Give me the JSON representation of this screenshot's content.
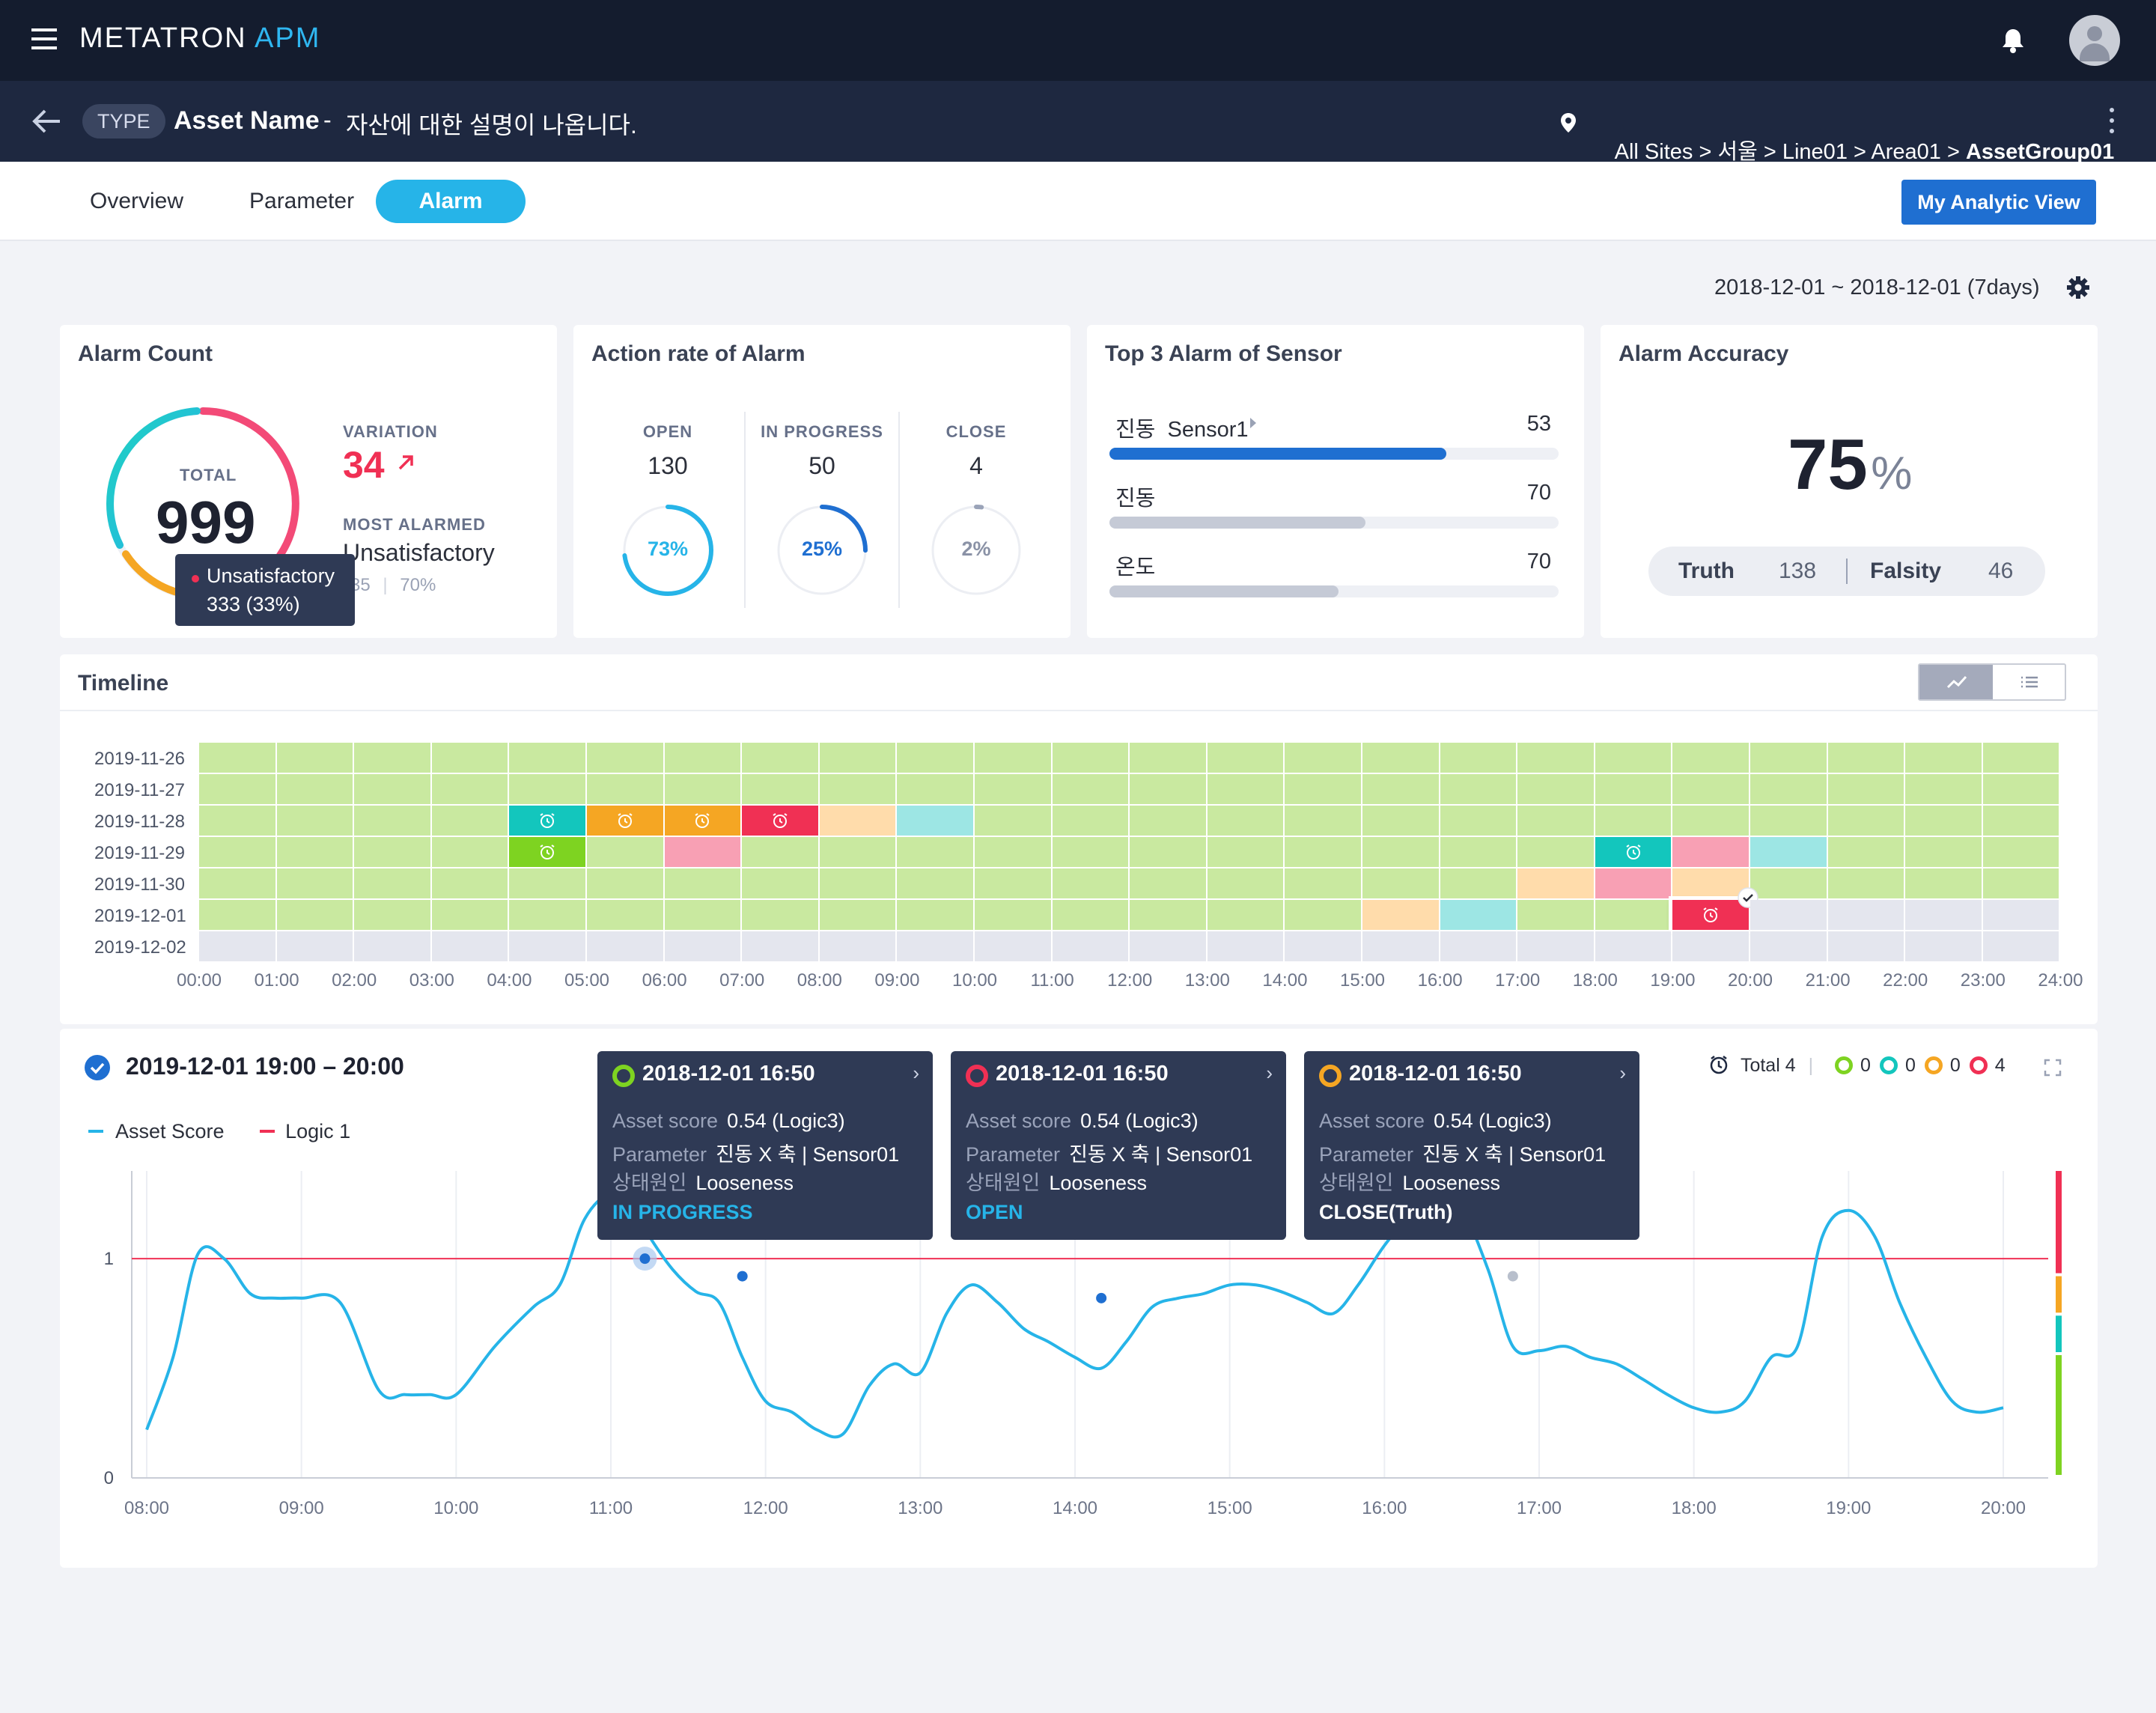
{
  "app": {
    "brand": "METATRON",
    "brand_accent": "APM"
  },
  "asset": {
    "type": "TYPE",
    "name": "Asset Name",
    "dash": "-",
    "description": "자산에 대한 설명이 나옵니다."
  },
  "breadcrumb": {
    "path": "All Sites > 서울 > Line01 > Area01 > ",
    "current": "AssetGroup01"
  },
  "tabs": [
    {
      "label": "Overview",
      "active": false
    },
    {
      "label": "Parameter",
      "active": false
    },
    {
      "label": "Alarm",
      "active": true
    }
  ],
  "my_view_button": "My Analytic View",
  "date_range": "2018-12-01 ~ 2018-12-01 (7days)",
  "alarm_count": {
    "title": "Alarm Count",
    "total_label": "TOTAL",
    "total": "999",
    "variation_label": "VARIATION",
    "variation": "34",
    "most_alarmed_label": "MOST ALARMED",
    "most_alarmed": "Unsatisfactory",
    "sub_count": "35",
    "sub_pct": "70%",
    "tooltip": {
      "label": "Unsatisfactory",
      "value": "333 (33%)"
    }
  },
  "action_rate": {
    "title": "Action rate of Alarm",
    "items": [
      {
        "label": "OPEN",
        "count": "130",
        "pct": "73%",
        "fraction": 0.73,
        "color": "#26b4e8"
      },
      {
        "label": "IN PROGRESS",
        "count": "50",
        "pct": "25%",
        "fraction": 0.25,
        "color": "#1f6fd1"
      },
      {
        "label": "CLOSE",
        "count": "4",
        "pct": "2%",
        "fraction": 0.02,
        "color": "#9aa3b8"
      }
    ]
  },
  "top3": {
    "title": "Top 3 Alarm of Sensor",
    "items": [
      {
        "label": "진동  Sensor1",
        "value": "53",
        "fraction": 0.75,
        "color": "#1f6fd1"
      },
      {
        "label": "진동",
        "value": "70",
        "fraction": 0.57,
        "color": "#c5cad6"
      },
      {
        "label": "온도",
        "value": "70",
        "fraction": 0.51,
        "color": "#c5cad6"
      }
    ]
  },
  "accuracy": {
    "title": "Alarm Accuracy",
    "value": "75",
    "unit": "%",
    "truth_label": "Truth",
    "truth": "138",
    "falsity_label": "Falsity",
    "falsity": "46"
  },
  "timeline": {
    "title": "Timeline",
    "dates": [
      "2019-11-26",
      "2019-11-27",
      "2019-11-28",
      "2019-11-29",
      "2019-11-30",
      "2019-12-01",
      "2019-12-02"
    ],
    "hours": [
      "00:00",
      "01:00",
      "02:00",
      "03:00",
      "04:00",
      "05:00",
      "06:00",
      "07:00",
      "08:00",
      "09:00",
      "10:00",
      "11:00",
      "12:00",
      "13:00",
      "14:00",
      "15:00",
      "16:00",
      "17:00",
      "18:00",
      "19:00",
      "20:00",
      "21:00",
      "22:00",
      "23:00",
      "24:00"
    ],
    "colors": {
      "normal": "#c9e9a0",
      "empty": "#e4e6ee",
      "teal": "#13c6bd",
      "green": "#7ed321",
      "orange": "#f5a623",
      "red": "#f03054",
      "peach": "#ffdcab",
      "cyan": "#9de6e4",
      "pink": "#f8a0b4"
    },
    "events": [
      {
        "row": 2,
        "col": 4,
        "c": "teal",
        "icon": true
      },
      {
        "row": 2,
        "col": 5,
        "c": "orange",
        "icon": true
      },
      {
        "row": 2,
        "col": 6,
        "c": "orange",
        "icon": true
      },
      {
        "row": 2,
        "col": 7,
        "c": "red",
        "icon": true
      },
      {
        "row": 2,
        "col": 8,
        "c": "peach",
        "icon": false
      },
      {
        "row": 2,
        "col": 9,
        "c": "cyan",
        "icon": false
      },
      {
        "row": 3,
        "col": 4,
        "c": "green",
        "icon": true
      },
      {
        "row": 3,
        "col": 6,
        "c": "pink",
        "icon": false
      },
      {
        "row": 3,
        "col": 18,
        "c": "teal",
        "icon": true
      },
      {
        "row": 3,
        "col": 19,
        "c": "pink",
        "icon": false
      },
      {
        "row": 3,
        "col": 20,
        "c": "cyan",
        "icon": false
      },
      {
        "row": 4,
        "col": 17,
        "c": "peach",
        "icon": false
      },
      {
        "row": 4,
        "col": 18,
        "c": "pink",
        "icon": false
      },
      {
        "row": 4,
        "col": 19,
        "c": "peach",
        "icon": false
      },
      {
        "row": 5,
        "col": 15,
        "c": "peach",
        "icon": false
      },
      {
        "row": 5,
        "col": 16,
        "c": "cyan",
        "icon": false
      },
      {
        "row": 5,
        "col": 19,
        "c": "red",
        "icon": true
      }
    ],
    "empty_from": {
      "row": 5,
      "col": 20
    }
  },
  "detail": {
    "period": "2019-12-01 19:00 – 20:00",
    "legend": [
      {
        "label": "Asset Score",
        "color": "#26b4e8"
      },
      {
        "label": "Logic 1",
        "color": "#f03054"
      }
    ],
    "total_label": "Total 4",
    "status_counts": [
      {
        "color": "#7ed321",
        "value": "0"
      },
      {
        "color": "#13c6bd",
        "value": "0"
      },
      {
        "color": "#f5a623",
        "value": "0"
      },
      {
        "color": "#f03054",
        "value": "4"
      }
    ],
    "tooltips": [
      {
        "time": "2018-12-01 16:50",
        "ring": "#7ed321",
        "score_label": "Asset score",
        "score": "0.54 (Logic3)",
        "param_label": "Parameter",
        "param": "진동 X 축 | Sensor01",
        "cause_label": "상태원인",
        "cause": "Looseness",
        "status": "IN PROGRESS",
        "status_color": "#26b4e8"
      },
      {
        "time": "2018-12-01 16:50",
        "ring": "#f03054",
        "score_label": "Asset score",
        "score": "0.54 (Logic3)",
        "param_label": "Parameter",
        "param": "진동 X 축 | Sensor01",
        "cause_label": "상태원인",
        "cause": "Looseness",
        "status": "OPEN",
        "status_color": "#26b4e8"
      },
      {
        "time": "2018-12-01 16:50",
        "ring": "#f5a623",
        "score_label": "Asset score",
        "score": "0.54 (Logic3)",
        "param_label": "Parameter",
        "param": "진동 X 축 | Sensor01",
        "cause_label": "상태원인",
        "cause": "Looseness",
        "status": "CLOSE(Truth)",
        "status_color": "#ffffff"
      }
    ]
  },
  "chart_data": {
    "type": "line",
    "x_ticks": [
      "08:00",
      "09:00",
      "10:00",
      "11:00",
      "12:00",
      "13:00",
      "14:00",
      "15:00",
      "16:00",
      "17:00",
      "18:00",
      "19:00",
      "20:00"
    ],
    "y_ticks": [
      "0",
      "1"
    ],
    "ylim": [
      0,
      1.4
    ],
    "threshold": {
      "name": "Logic 1",
      "value": 1
    },
    "series": [
      {
        "name": "Asset Score",
        "x": [
          8.0,
          8.17,
          8.33,
          8.5,
          8.67,
          8.83,
          9.0,
          9.25,
          9.5,
          9.67,
          9.83,
          10.0,
          10.25,
          10.5,
          10.67,
          10.83,
          11.0,
          11.13,
          11.25,
          11.4,
          11.55,
          11.7,
          11.85,
          12.0,
          12.17,
          12.33,
          12.5,
          12.67,
          12.83,
          13.0,
          13.17,
          13.33,
          13.5,
          13.67,
          13.83,
          14.0,
          14.17,
          14.33,
          14.5,
          14.67,
          14.83,
          15.0,
          15.17,
          15.33,
          15.5,
          15.67,
          15.83,
          16.0,
          16.17,
          16.33,
          16.5,
          16.67,
          16.83,
          17.0,
          17.17,
          17.33,
          17.5,
          17.67,
          17.83,
          18.0,
          18.17,
          18.33,
          18.5,
          18.67,
          18.83,
          19.0,
          19.17,
          19.33,
          19.5,
          19.67,
          19.83,
          20.0
        ],
        "y": [
          0.22,
          0.55,
          1.02,
          1.0,
          0.84,
          0.82,
          0.82,
          0.8,
          0.4,
          0.38,
          0.38,
          0.38,
          0.6,
          0.78,
          0.88,
          1.18,
          1.3,
          1.25,
          1.1,
          0.95,
          0.85,
          0.8,
          0.55,
          0.35,
          0.3,
          0.22,
          0.2,
          0.42,
          0.52,
          0.48,
          0.75,
          0.88,
          0.8,
          0.68,
          0.62,
          0.55,
          0.5,
          0.62,
          0.78,
          0.82,
          0.84,
          0.88,
          0.88,
          0.85,
          0.8,
          0.75,
          0.88,
          1.06,
          1.2,
          1.25,
          1.22,
          0.95,
          0.6,
          0.58,
          0.6,
          0.55,
          0.52,
          0.45,
          0.38,
          0.32,
          0.3,
          0.35,
          0.55,
          0.6,
          1.1,
          1.22,
          1.1,
          0.8,
          0.55,
          0.35,
          0.3,
          0.32
        ],
        "color": "#26b4e8"
      }
    ],
    "markers": [
      {
        "x": 11.22,
        "y": 1.0,
        "color": "#1f6fd1",
        "highlight": true
      },
      {
        "x": 11.85,
        "y": 0.92,
        "color": "#1f6fd1",
        "highlight": false
      },
      {
        "x": 14.17,
        "y": 0.82,
        "color": "#1f6fd1",
        "highlight": false
      },
      {
        "x": 16.83,
        "y": 0.92,
        "color": "#b8bfcc",
        "highlight": false
      },
      {
        "x": 16.98,
        "y": 1.12,
        "color": "#1f6fd1",
        "highlight": false
      }
    ],
    "status_bar": [
      {
        "color": "#f03054",
        "from": 1.4,
        "to": 0.92
      },
      {
        "color": "#f5a623",
        "from": 0.92,
        "to": 0.74
      },
      {
        "color": "#13c6bd",
        "from": 0.74,
        "to": 0.56
      },
      {
        "color": "#7ed321",
        "from": 0.56,
        "to": 0.0
      }
    ]
  }
}
